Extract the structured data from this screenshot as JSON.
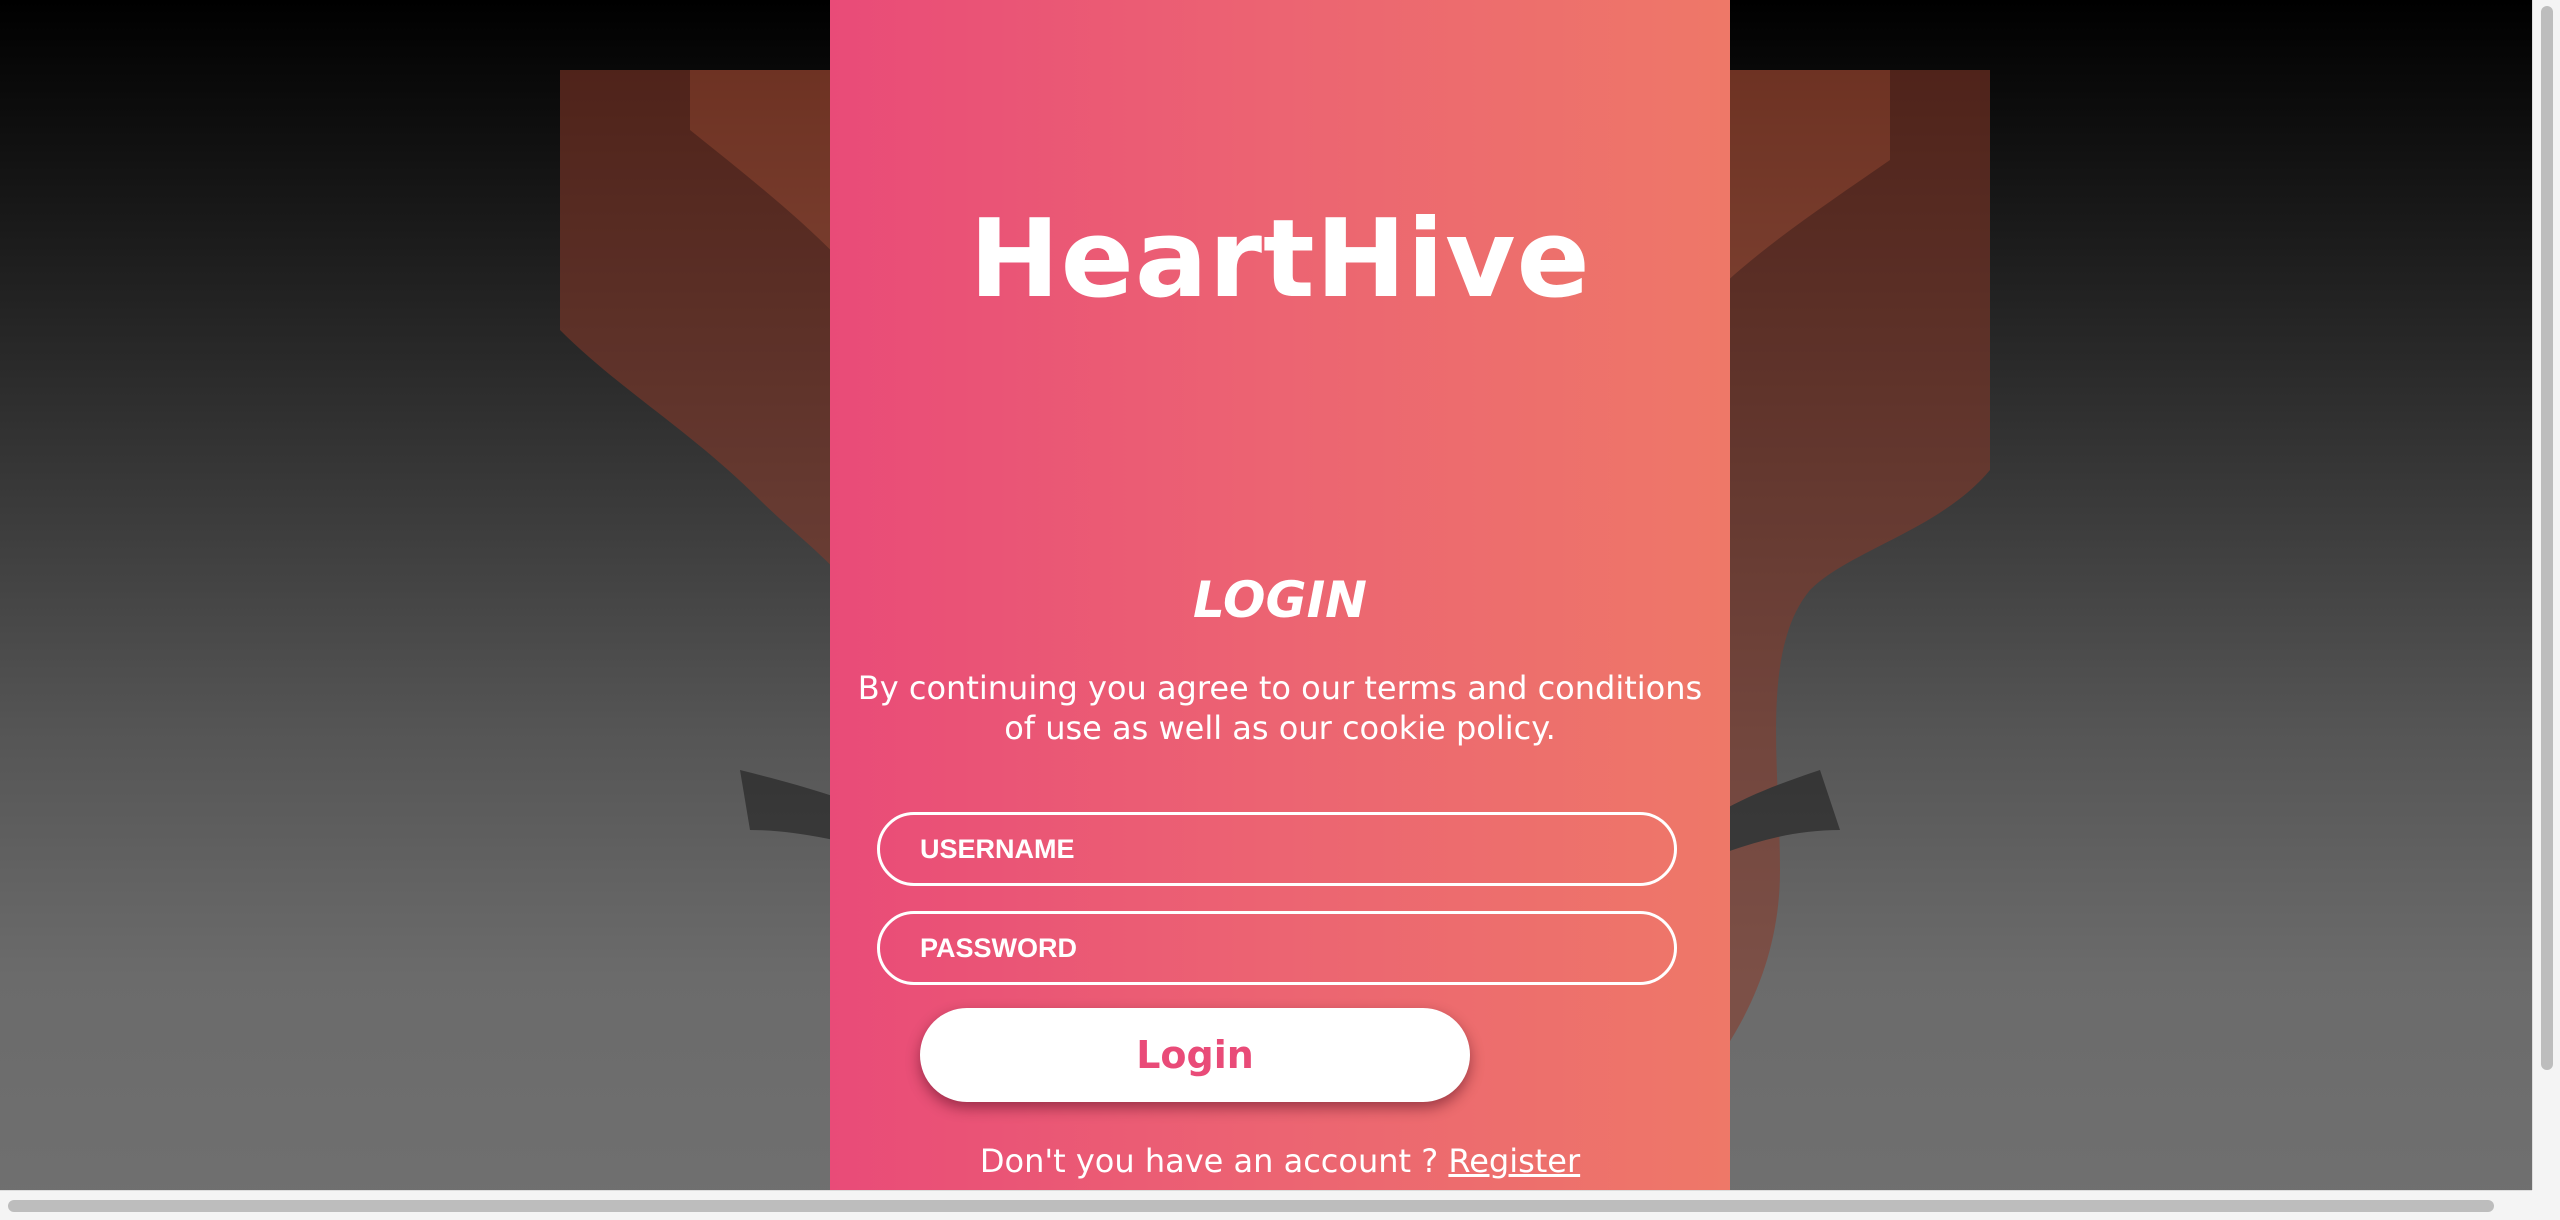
{
  "brand": {
    "name": "HeartHive"
  },
  "login_form": {
    "heading": "LOGIN",
    "terms_text": "By continuing you agree to our terms and conditions of use as well as our cookie policy.",
    "username_placeholder": "USERNAME",
    "password_placeholder": "PASSWORD",
    "submit_label": "Login",
    "register_prompt": "Don't you have an account ?",
    "register_link": "Register"
  },
  "colors": {
    "panel_gradient_start": "#e94b78",
    "panel_gradient_end": "#ee7868",
    "button_text": "#e94b78",
    "text": "#ffffff"
  }
}
